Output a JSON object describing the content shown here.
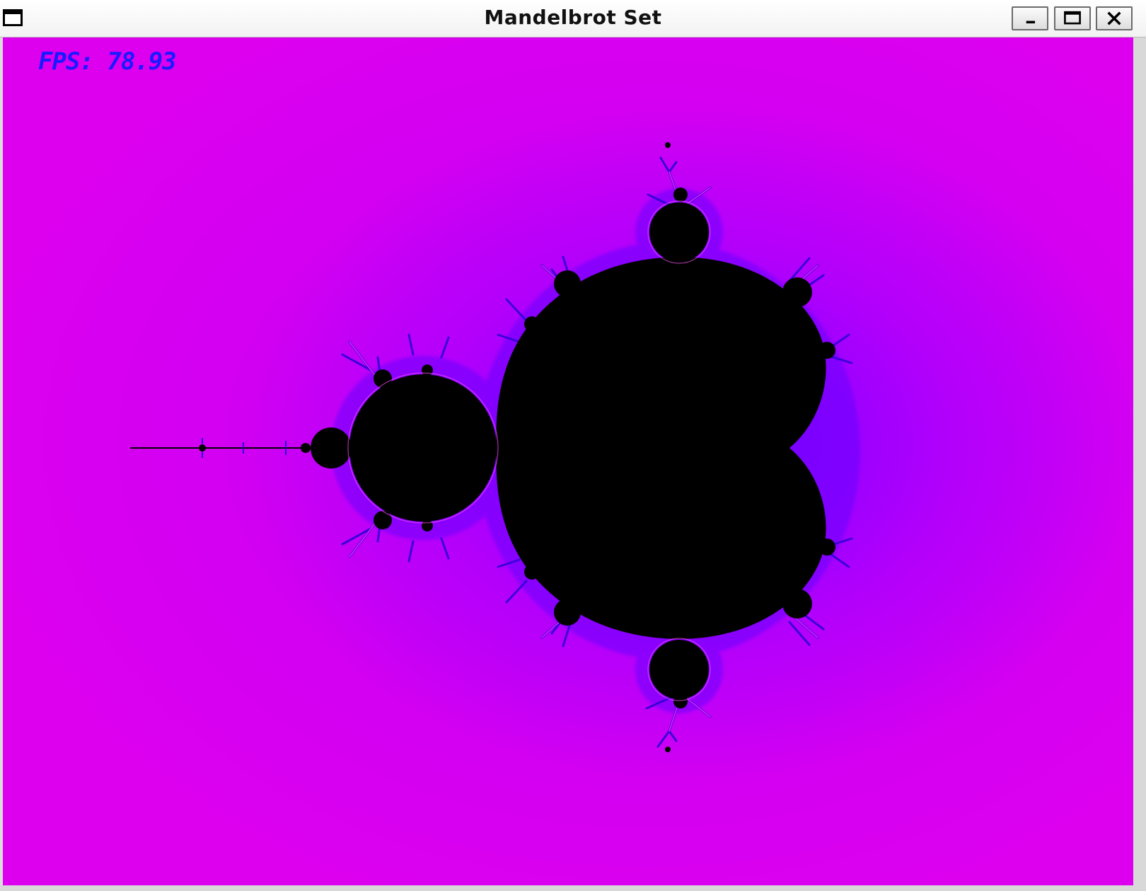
{
  "window": {
    "title": "Mandelbrot Set",
    "icon": "window-app-icon",
    "controls": {
      "minimize_icon": "minimize-icon",
      "maximize_icon": "maximize-icon",
      "close_icon": "close-icon"
    }
  },
  "overlay": {
    "fps_text": "FPS: 78.93"
  },
  "colors": {
    "background": "#e100ee",
    "glow": "#7e00ff",
    "set": "#000000",
    "fps_text": "#1a1aff"
  }
}
